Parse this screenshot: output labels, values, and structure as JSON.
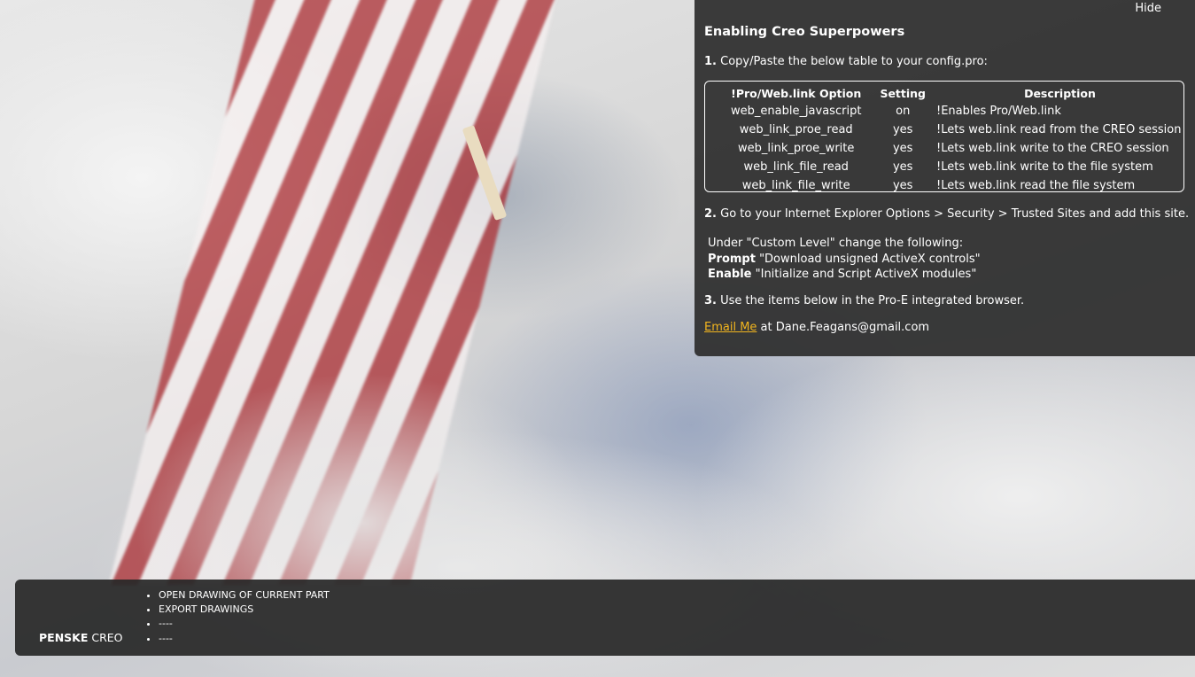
{
  "panel": {
    "hide_label": "Hide",
    "title": "Enabling Creo Superpowers",
    "step1": {
      "num": "1.",
      "text": " Copy/Paste the below table to your config.pro:"
    },
    "table": {
      "headers": [
        "!Pro/Web.link Option",
        "Setting",
        "Description"
      ],
      "rows": [
        [
          "web_enable_javascript",
          "on",
          "!Enables Pro/Web.link"
        ],
        [
          "web_link_proe_read",
          "yes",
          "!Lets web.link read from the CREO session"
        ],
        [
          "web_link_proe_write",
          "yes",
          "!Lets web.link write to the CREO session"
        ],
        [
          "web_link_file_read",
          "yes",
          "!Lets web.link write to the file system"
        ],
        [
          "web_link_file_write",
          "yes",
          "!Lets web.link read the file system"
        ]
      ]
    },
    "step2": {
      "num": "2.",
      "text": " Go to your Internet Explorer Options > Security > Trusted Sites and add this site."
    },
    "custom": {
      "intro": "Under \"Custom Level\" change the following:",
      "prompt_label": "Prompt",
      "prompt_text": " \"Download unsigned ActiveX controls\"",
      "enable_label": "Enable",
      "enable_text": " \"Initialize and Script ActiveX modules\""
    },
    "step3": {
      "num": "3.",
      "text": " Use the items below in the Pro-E integrated browser."
    },
    "email": {
      "link_label": "Email Me",
      "text": " at Dane.Feagans@gmail.com"
    }
  },
  "footer": {
    "brand_bold": "PENSKE",
    "brand_rest": " CREO",
    "menu": [
      "OPEN DRAWING OF CURRENT PART",
      "EXPORT DRAWINGS",
      "----",
      "----"
    ]
  },
  "colors": {
    "link": "#f2b51e",
    "panel_bg": "#2d2d2d"
  }
}
